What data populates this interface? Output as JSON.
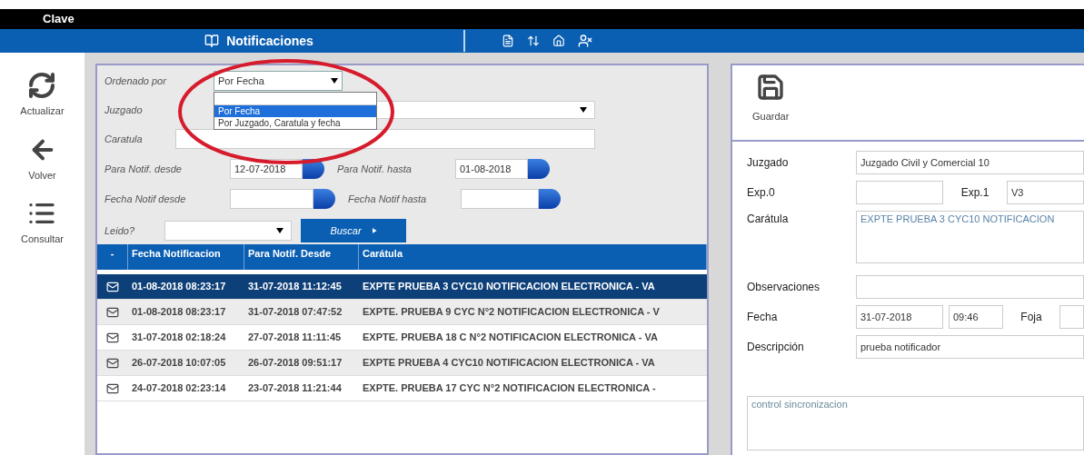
{
  "top_bar": {
    "title": "Clave"
  },
  "header": {
    "title": "Notificaciones"
  },
  "sidebar": [
    {
      "label": "Actualizar",
      "kind": "refresh"
    },
    {
      "label": "Volver",
      "kind": "back"
    },
    {
      "label": "Consultar",
      "kind": "list"
    }
  ],
  "filters": {
    "order": {
      "label": "Ordenado por",
      "value": "Por Fecha",
      "expanded": true,
      "options": [
        {
          "label": "Por Fecha",
          "selected": true
        },
        {
          "label": "Por Juzgado, Caratula y fecha",
          "selected": false
        }
      ]
    },
    "juzgado": {
      "label": "Juzgado"
    },
    "caratula": {
      "label": "Caratula"
    },
    "para_desde": {
      "label": "Para Notif. desde",
      "value": "12-07-2018"
    },
    "para_hasta": {
      "label": "Para Notif. hasta",
      "value": "01-08-2018"
    },
    "fecha_desde": {
      "label": "Fecha Notif desde"
    },
    "fecha_hasta": {
      "label": "Fecha Notif hasta"
    },
    "leido": {
      "label": "Leido?"
    },
    "search_button": "Buscar"
  },
  "table": {
    "icon_column_header": "-",
    "columns": [
      "Fecha Notificacion",
      "Para Notif. Desde",
      "Carátula"
    ],
    "rows": [
      {
        "selected": true,
        "cells": [
          "01-08-2018 08:23:17",
          "31-07-2018 11:12:45",
          "EXPTE PRUEBA 3 CYC10 NOTIFICACION ELECTRONICA - VA"
        ]
      },
      {
        "selected": false,
        "cells": [
          "01-08-2018 08:23:17",
          "31-07-2018 07:47:52",
          "EXPTE. PRUEBA 9 CYC N°2 NOTIFICACION ELECTRONICA - V"
        ]
      },
      {
        "selected": false,
        "cells": [
          "31-07-2018 02:18:24",
          "27-07-2018 11:11:45",
          "EXPTE. PRUEBA 18 C N°2 NOTIFICACION ELECTRONICA - VA"
        ]
      },
      {
        "selected": false,
        "cells": [
          "26-07-2018 10:07:05",
          "26-07-2018 09:51:17",
          "EXPTE PRUEBA 4 CYC10 NOTIFICACION ELECTRONICA - VA"
        ]
      },
      {
        "selected": false,
        "cells": [
          "24-07-2018 02:23:14",
          "23-07-2018 11:21:44",
          "EXPTE. PRUEBA 17 CYC N°2 NOTIFICACION ELECTRONICA -"
        ]
      }
    ]
  },
  "detail": {
    "save_button": "Guardar",
    "juzgado": {
      "label": "Juzgado",
      "value": "Juzgado Civil y Comercial 10"
    },
    "exp0": {
      "label": "Exp.0"
    },
    "exp1": {
      "label": "Exp.1",
      "value": "V3"
    },
    "caratula": {
      "label": "Carátula",
      "value": "EXPTE PRUEBA 3 CYC10 NOTIFICACION"
    },
    "observaciones": {
      "label": "Observaciones"
    },
    "fecha": {
      "label": "Fecha",
      "date": "31-07-2018",
      "time": "09:46"
    },
    "foja": {
      "label": "Foja"
    },
    "descripcion": {
      "label": "Descripción",
      "value": "prueba notificador"
    },
    "notes": "control sincronizacion"
  }
}
